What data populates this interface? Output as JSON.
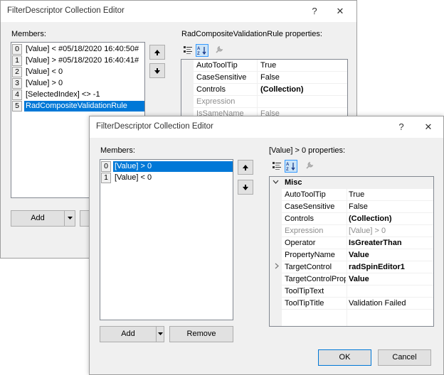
{
  "back_dialog": {
    "title": "FilterDescriptor Collection Editor",
    "help": "?",
    "close": "✕",
    "members_label": "Members:",
    "properties_label": "RadCompositeValidationRule properties:",
    "members": [
      {
        "index": "0",
        "text": "[Value] < #05/18/2020 16:40:50#"
      },
      {
        "index": "1",
        "text": "[Value] > #05/18/2020 16:40:41#"
      },
      {
        "index": "2",
        "text": "[Value] < 0"
      },
      {
        "index": "3",
        "text": "[Value] > 0"
      },
      {
        "index": "4",
        "text": "[SelectedIndex] <> -1"
      },
      {
        "index": "5",
        "text": "RadCompositeValidationRule"
      }
    ],
    "properties": [
      {
        "name": "AutoToolTip",
        "value": "True"
      },
      {
        "name": "CaseSensitive",
        "value": "False"
      },
      {
        "name": "Controls",
        "value": "(Collection)"
      },
      {
        "name": "Expression",
        "value": ""
      },
      {
        "name": "IsSameName",
        "value": "False"
      }
    ],
    "add_label": "Add"
  },
  "front_dialog": {
    "title": "FilterDescriptor Collection Editor",
    "help": "?",
    "close": "✕",
    "members_label": "Members:",
    "properties_label": "[Value] > 0 properties:",
    "members": [
      {
        "index": "0",
        "text": "[Value] > 0"
      },
      {
        "index": "1",
        "text": "[Value] < 0"
      }
    ],
    "category": "Misc",
    "properties": [
      {
        "name": "AutoToolTip",
        "value": "True"
      },
      {
        "name": "CaseSensitive",
        "value": "False"
      },
      {
        "name": "Controls",
        "value": "(Collection)"
      },
      {
        "name": "Expression",
        "value": "[Value] > 0"
      },
      {
        "name": "Operator",
        "value": "IsGreaterThan"
      },
      {
        "name": "PropertyName",
        "value": "Value"
      },
      {
        "name": "TargetControl",
        "value": "radSpinEditor1"
      },
      {
        "name": "TargetControlPrope",
        "value": "Value"
      },
      {
        "name": "ToolTipText",
        "value": ""
      },
      {
        "name": "ToolTipTitle",
        "value": "Validation Failed"
      }
    ],
    "add_label": "Add",
    "remove_label": "Remove",
    "ok_label": "OK",
    "cancel_label": "Cancel"
  },
  "colors": {
    "selection": "#0078d7",
    "window_bg": "#f0f0f0",
    "border": "#828790"
  }
}
